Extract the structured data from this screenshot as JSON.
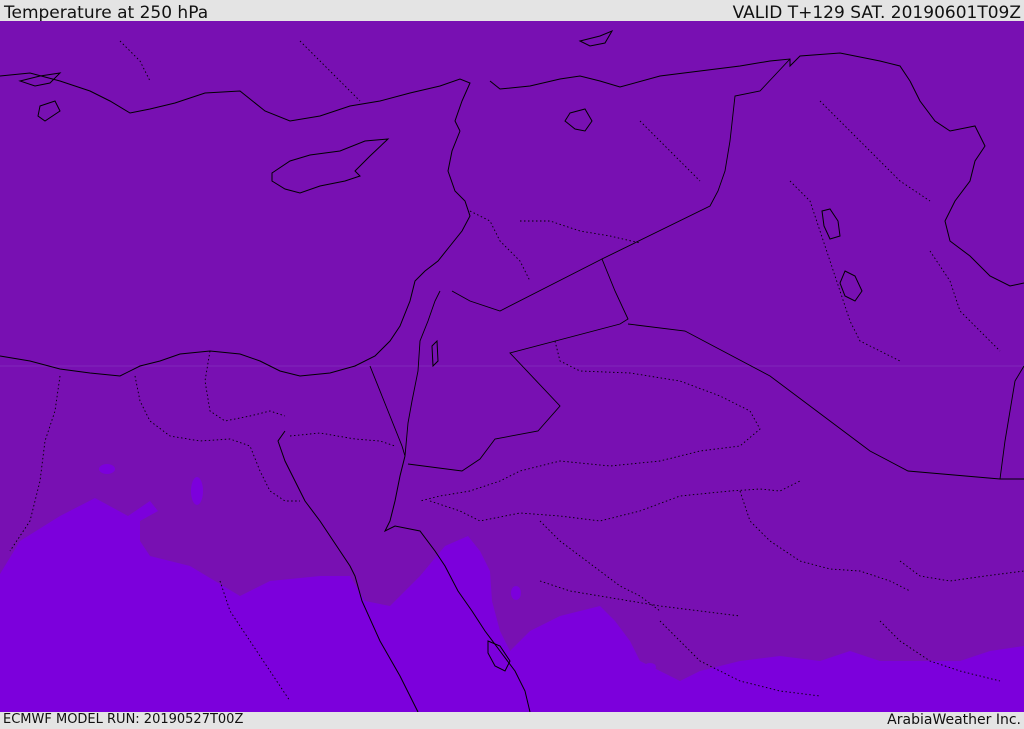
{
  "header": {
    "title": "Temperature at 250 hPa",
    "valid": "VALID T+129 SAT. 20190601T09Z"
  },
  "footer": {
    "model_run": "ECMWF MODEL RUN: 20190527T00Z",
    "credit": "ArabiaWeather Inc."
  },
  "map": {
    "fill_colors": {
      "main": "#7810b2",
      "south_band": "#7c00dc",
      "coast_line": "#000000"
    }
  }
}
